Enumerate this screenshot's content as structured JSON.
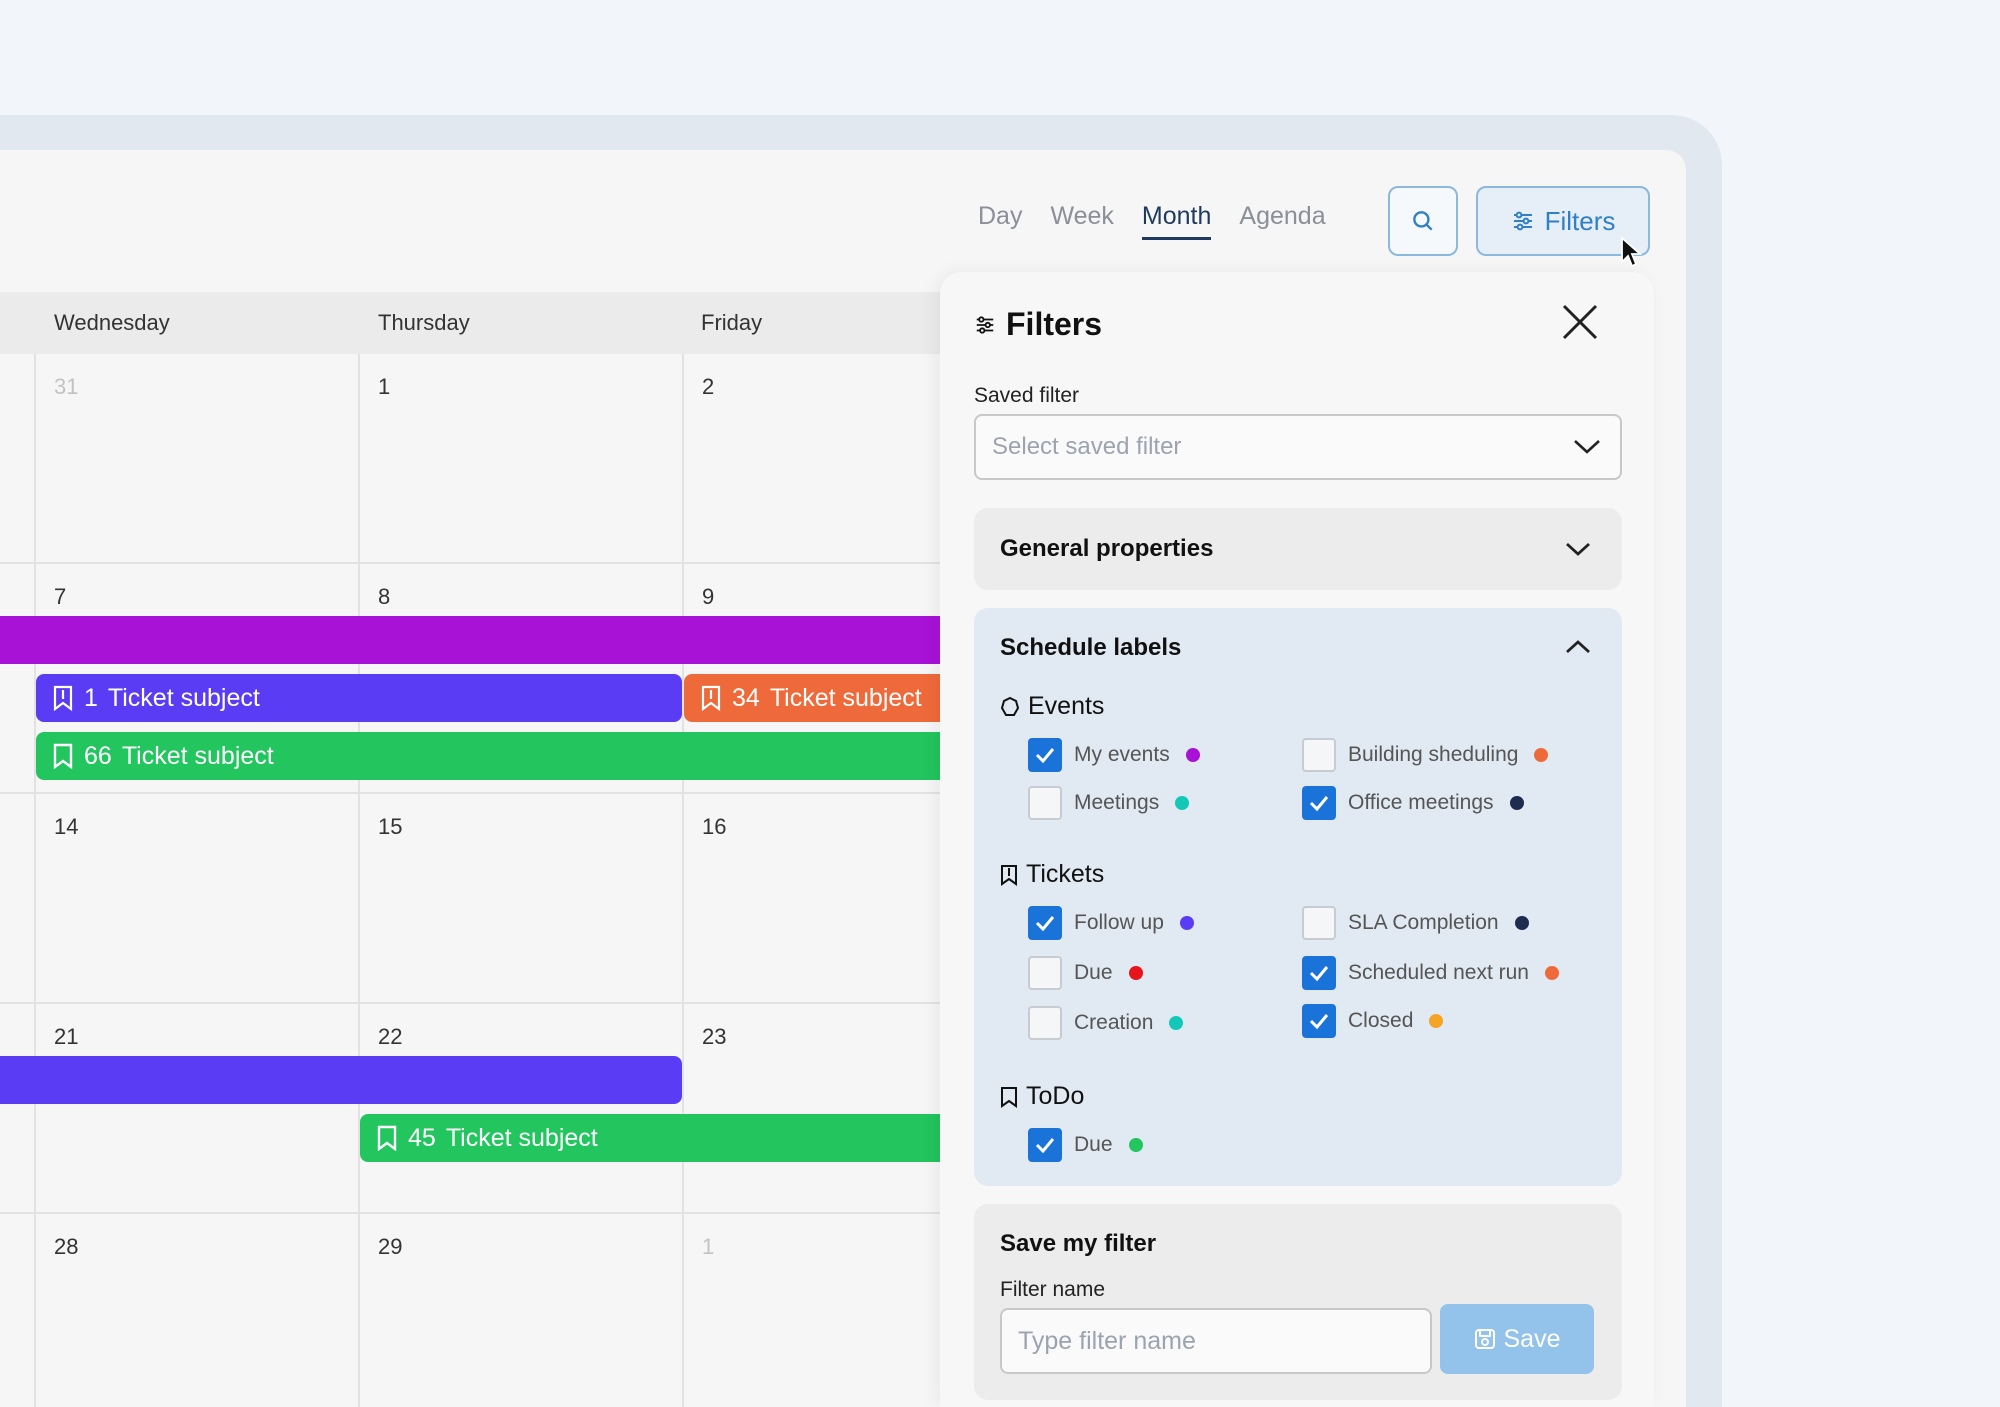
{
  "view_tabs": [
    "Day",
    "Week",
    "Month",
    "Agenda"
  ],
  "active_view": "Month",
  "filters_button": {
    "label": "Filters"
  },
  "calendar": {
    "day_names": [
      "Wednesday",
      "Thursday",
      "Friday"
    ],
    "weeks": [
      [
        "31",
        "1",
        "2"
      ],
      [
        "7",
        "8",
        "9"
      ],
      [
        "14",
        "15",
        "16"
      ],
      [
        "21",
        "22",
        "23"
      ],
      [
        "28",
        "29",
        "1"
      ]
    ],
    "events": [
      {
        "number": "1",
        "title": "Ticket subject",
        "color": "#5b3cf5"
      },
      {
        "number": "34",
        "title": "Ticket subject",
        "color": "#ef6a3a"
      },
      {
        "number": "66",
        "title": "Ticket subject",
        "color": "#22c55e"
      },
      {
        "number": "45",
        "title": "Ticket subject",
        "color": "#22c55e"
      }
    ],
    "bar_colors": {
      "purple": "#a712d6",
      "indigo": "#5b3cf5"
    }
  },
  "filter_panel": {
    "title": "Filters",
    "saved_filter": {
      "label": "Saved filter",
      "placeholder": "Select saved filter"
    },
    "general_properties": {
      "title": "General properties"
    },
    "schedule_labels": {
      "title": "Schedule labels",
      "groups": [
        {
          "name": "Events",
          "items": [
            {
              "label": "My events",
              "checked": true,
              "color": "#a712d6"
            },
            {
              "label": "Building sheduling",
              "checked": false,
              "color": "#ef6a3a"
            },
            {
              "label": "Meetings",
              "checked": false,
              "color": "#14c8b8"
            },
            {
              "label": "Office meetings",
              "checked": true,
              "color": "#1e2d4f"
            }
          ]
        },
        {
          "name": "Tickets",
          "items": [
            {
              "label": "Follow up",
              "checked": true,
              "color": "#5b3cf5"
            },
            {
              "label": "SLA Completion",
              "checked": false,
              "color": "#1e2d4f"
            },
            {
              "label": "Due",
              "checked": false,
              "color": "#e8141c"
            },
            {
              "label": "Scheduled next run",
              "checked": true,
              "color": "#ef6a3a"
            },
            {
              "label": "Creation",
              "checked": false,
              "color": "#14c8b8"
            },
            {
              "label": "Closed",
              "checked": true,
              "color": "#f5a524"
            }
          ]
        },
        {
          "name": "ToDo",
          "items": [
            {
              "label": "Due",
              "checked": true,
              "color": "#22c55e"
            }
          ]
        }
      ]
    },
    "save_filter": {
      "title": "Save my filter",
      "name_label": "Filter name",
      "placeholder": "Type filter name",
      "button": "Save"
    }
  }
}
